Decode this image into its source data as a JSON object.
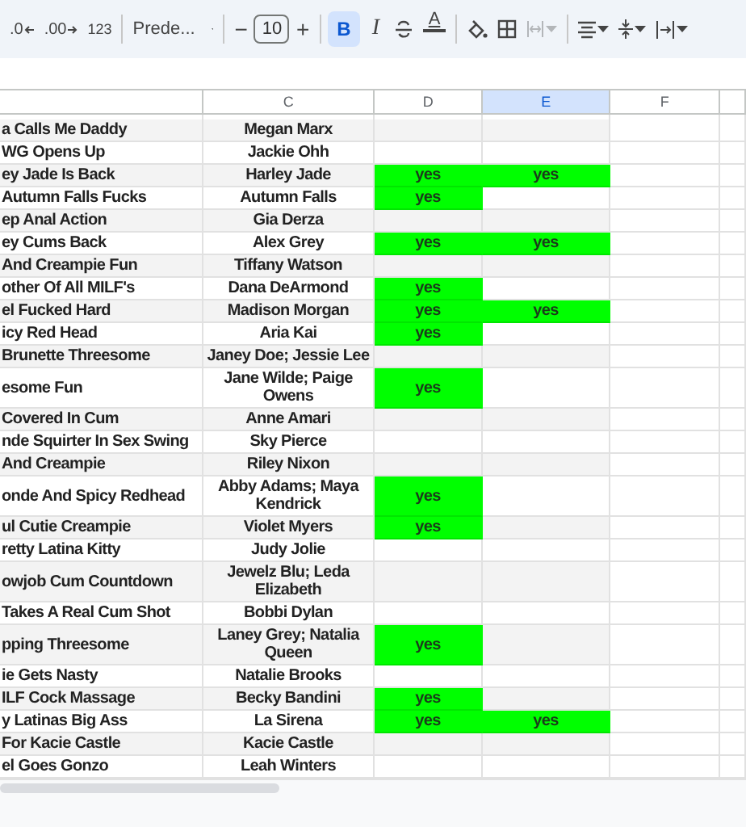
{
  "toolbar": {
    "decrease_decimals": ".0",
    "increase_decimals": ".00",
    "number_format": "123",
    "font": "Prede...",
    "decrease_size": "−",
    "font_size": "10",
    "increase_size": "+",
    "bold": {
      "label": "B",
      "selected": true
    },
    "italic": {
      "label": "I",
      "selected": false
    },
    "text_color": "A",
    "merge": {
      "disabled": true
    }
  },
  "columns": [
    {
      "selected": false
    },
    {
      "label": "C",
      "selected": false
    },
    {
      "label": "D",
      "selected": false
    },
    {
      "label": "E",
      "selected": true
    },
    {
      "label": "F",
      "selected": false
    },
    {
      "selected": false
    }
  ],
  "rows": [
    {
      "title": "a Calls Me Daddy",
      "performers": "Megan Marx"
    },
    {
      "title": "WG Opens Up",
      "performers": "Jackie Ohh"
    },
    {
      "title": "ey Jade Is Back",
      "performers": "Harley Jade",
      "d": "yes",
      "e": "yes"
    },
    {
      "title": "Autumn Falls Fucks",
      "performers": "Autumn Falls",
      "d": "yes"
    },
    {
      "title": "ep Anal Action",
      "performers": "Gia Derza"
    },
    {
      "title": "ey Cums Back",
      "performers": "Alex Grey",
      "d": "yes",
      "e": "yes"
    },
    {
      "title": "And Creampie Fun",
      "performers": "Tiffany Watson"
    },
    {
      "title": "other Of All MILF's",
      "performers": "Dana DeArmond",
      "d": "yes"
    },
    {
      "title": "el Fucked Hard",
      "performers": "Madison Morgan",
      "d": "yes",
      "e": "yes"
    },
    {
      "title": "icy Red Head",
      "performers": "Aria Kai",
      "d": "yes"
    },
    {
      "title": "Brunette Threesome",
      "performers": "Janey Doe; Jessie Lee"
    },
    {
      "title": "esome Fun",
      "performers": "Jane Wilde; Paige Owens",
      "d": "yes"
    },
    {
      "title": "Covered In Cum",
      "performers": "Anne Amari"
    },
    {
      "title": "nde Squirter In Sex Swing",
      "performers": "Sky Pierce"
    },
    {
      "title": "And Creampie",
      "performers": "Riley Nixon"
    },
    {
      "title": "onde And Spicy Redhead",
      "performers": "Abby Adams; Maya Kendrick",
      "d": "yes"
    },
    {
      "title": "ul Cutie Creampie",
      "performers": "Violet Myers",
      "d": "yes"
    },
    {
      "title": "retty Latina Kitty",
      "performers": "Judy Jolie"
    },
    {
      "title": "owjob Cum Countdown",
      "performers": "Jewelz Blu; Leda Elizabeth"
    },
    {
      "title": "Takes A Real Cum Shot",
      "performers": "Bobbi Dylan"
    },
    {
      "title": "pping Threesome",
      "performers": "Laney Grey; Natalia Queen",
      "d": "yes"
    },
    {
      "title": "ie Gets Nasty",
      "performers": "Natalie Brooks"
    },
    {
      "title": "ILF Cock Massage",
      "performers": "Becky Bandini",
      "d": "yes"
    },
    {
      "title": "y Latinas Big Ass",
      "performers": "La Sirena",
      "d": "yes",
      "e": "yes"
    },
    {
      "title": "For Kacie Castle",
      "performers": "Kacie Castle"
    },
    {
      "title": "el Goes Gonzo",
      "performers": "Leah Winters"
    }
  ]
}
